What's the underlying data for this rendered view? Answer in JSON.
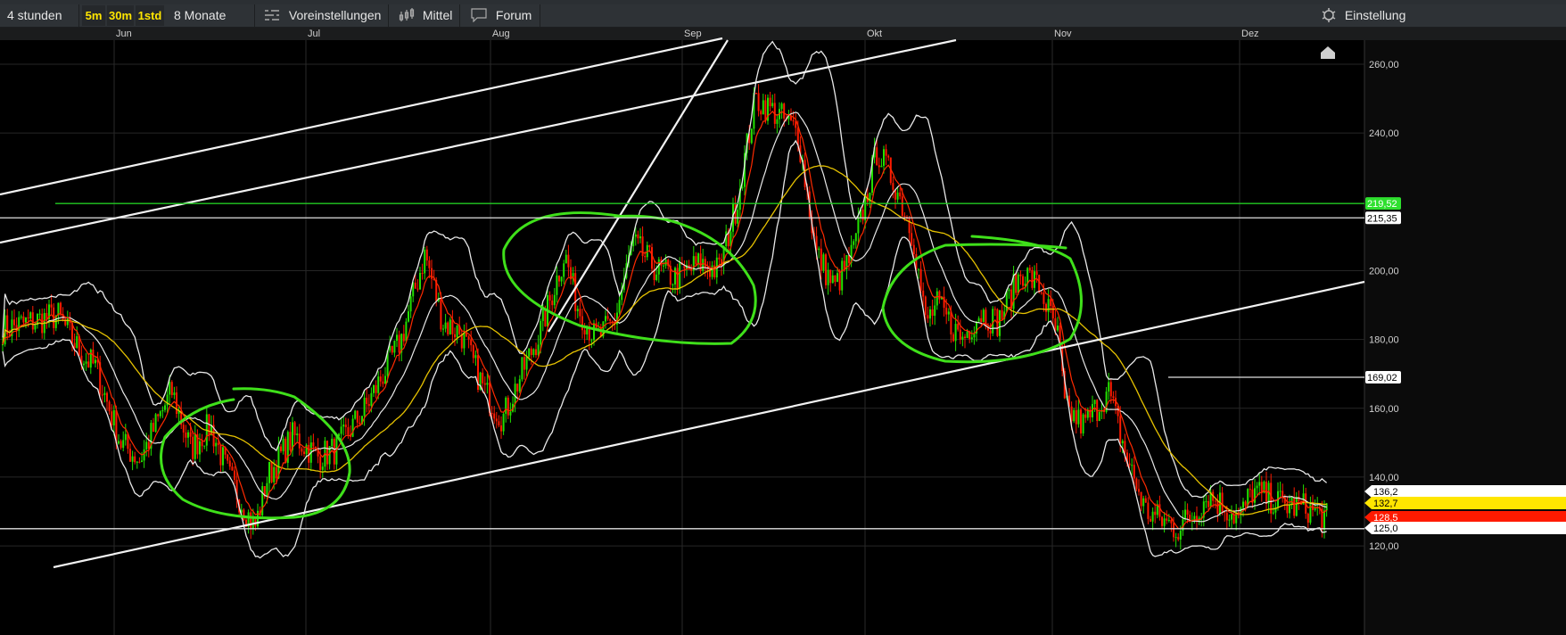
{
  "toolbar": {
    "interval": "4 stunden",
    "resolutions": [
      "5m",
      "30m",
      "1std"
    ],
    "range": "8 Monate",
    "presets_label": "Voreinstellungen",
    "presets_icon": "sliders-icon",
    "indicators_label": "Mittel",
    "indicators_icon": "candlestick-icon",
    "forum_label": "Forum",
    "forum_icon": "speech-bubble-icon",
    "settings_label": "Einstellung",
    "settings_icon": "gear-icon"
  },
  "colors": {
    "up": "#22e000",
    "down": "#ff1a00",
    "bands": "#e8e8e8",
    "slow_ma": "#e6c200",
    "fast_ma": "#ff2a00",
    "annotation": "#3fe01a",
    "level_green": "#22cc22"
  },
  "chart_data": {
    "type": "candlestick",
    "x_ticks": [
      {
        "label": "Jun",
        "date": "06-01"
      },
      {
        "label": "Jul",
        "date": "07-01"
      },
      {
        "label": "Aug",
        "date": "08-01"
      },
      {
        "label": "Sep",
        "date": "09-01"
      },
      {
        "label": "Okt",
        "date": "10-01"
      },
      {
        "label": "Nov",
        "date": "11-01"
      },
      {
        "label": "Dez",
        "date": "12-01"
      }
    ],
    "y_ticks": [
      "260,00",
      "240,00",
      "200,00",
      "180,00",
      "160,00",
      "140,00",
      "120,00"
    ],
    "y_tick_values": [
      260,
      240,
      200,
      180,
      160,
      140,
      120
    ],
    "ylim": [
      113.8,
      267
    ],
    "xlim": [
      "05-14",
      "12-20"
    ],
    "grid": true,
    "price_path": [
      [
        "05-14",
        183
      ],
      [
        "05-23",
        187
      ],
      [
        "05-27",
        175
      ],
      [
        "05-29",
        172
      ],
      [
        "06-02",
        150
      ],
      [
        "06-05",
        145
      ],
      [
        "06-10",
        165
      ],
      [
        "06-13",
        148
      ],
      [
        "06-16",
        155
      ],
      [
        "06-19",
        140
      ],
      [
        "06-23",
        125
      ],
      [
        "06-25",
        140
      ],
      [
        "06-29",
        152
      ],
      [
        "07-03",
        146
      ],
      [
        "07-06",
        148
      ],
      [
        "07-11",
        160
      ],
      [
        "07-17",
        180
      ],
      [
        "07-21",
        205
      ],
      [
        "07-24",
        185
      ],
      [
        "07-27",
        182
      ],
      [
        "07-31",
        165
      ],
      [
        "08-03",
        157
      ],
      [
        "08-06",
        170
      ],
      [
        "08-09",
        182
      ],
      [
        "08-13",
        205
      ],
      [
        "08-15",
        190
      ],
      [
        "08-18",
        180
      ],
      [
        "08-21",
        185
      ],
      [
        "08-24",
        208
      ],
      [
        "08-28",
        200
      ],
      [
        "08-31",
        198
      ],
      [
        "09-04",
        202
      ],
      [
        "09-07",
        200
      ],
      [
        "09-10",
        220
      ],
      [
        "09-13",
        250
      ],
      [
        "09-17",
        245
      ],
      [
        "09-20",
        240
      ],
      [
        "09-23",
        205
      ],
      [
        "09-26",
        195
      ],
      [
        "09-29",
        205
      ],
      [
        "10-03",
        235
      ],
      [
        "10-06",
        225
      ],
      [
        "10-09",
        210
      ],
      [
        "10-11",
        185
      ],
      [
        "10-13",
        190
      ],
      [
        "10-17",
        180
      ],
      [
        "10-20",
        188
      ],
      [
        "10-23",
        185
      ],
      [
        "10-27",
        200
      ],
      [
        "10-30",
        195
      ],
      [
        "11-02",
        180
      ],
      [
        "11-03",
        160
      ],
      [
        "11-06",
        155
      ],
      [
        "11-10",
        165
      ],
      [
        "11-13",
        145
      ],
      [
        "11-16",
        130
      ],
      [
        "11-21",
        125
      ],
      [
        "11-24",
        130
      ],
      [
        "11-26",
        135
      ],
      [
        "12-01",
        128
      ],
      [
        "12-03",
        136
      ],
      [
        "12-08",
        132
      ],
      [
        "12-12",
        131
      ],
      [
        "12-15",
        128
      ]
    ],
    "levels": [
      {
        "label": "219,52",
        "value": 219.52,
        "style": "green"
      },
      {
        "label": "215,35",
        "value": 215.35,
        "style": "white"
      },
      {
        "label": "169,02",
        "value": 169.02,
        "style": "white"
      },
      {
        "label": "125,0",
        "value": 125.0,
        "style": "white"
      }
    ],
    "price_tags": [
      {
        "label": "136,2",
        "value": 136.2,
        "style": "white"
      },
      {
        "label": "132,7",
        "value": 132.7,
        "style": "yellow"
      },
      {
        "label": "128,5",
        "value": 128.5,
        "style": "red"
      },
      {
        "label": "125,0",
        "value": 125.0,
        "style": "white"
      }
    ]
  }
}
